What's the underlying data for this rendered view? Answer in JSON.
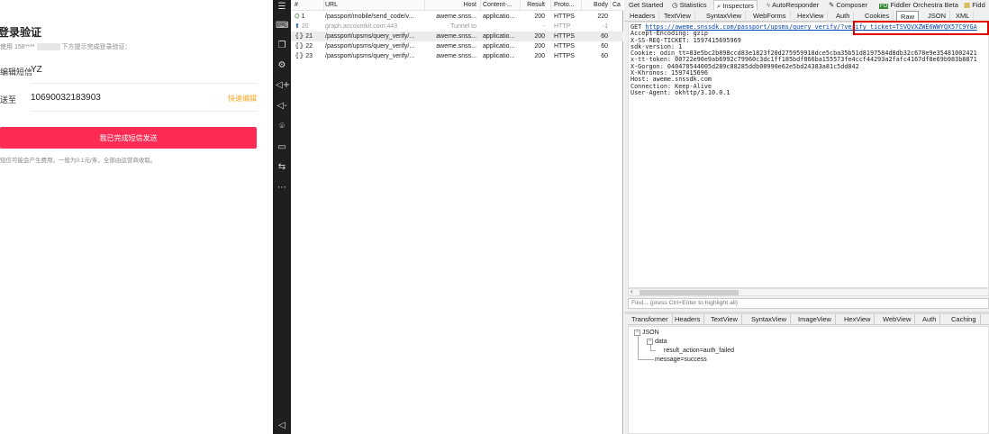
{
  "phone": {
    "title": "登录验证",
    "subtitle_prefix": "使用 158****",
    "subtitle_suffix": "下方提示完成登录验证：",
    "sms_label": "编辑短信",
    "sms_value": "YZ",
    "send_to_label": "送至",
    "send_to_value": "10690032183903",
    "quick_edit": "快速编辑",
    "confirm_button": "我已完成短信发送",
    "note": "短信可能会产生费用，一般为0.1元/条，全部由运营商收取。",
    "button_color": "#fe2c55"
  },
  "sidebar_icons": [
    "list-icon",
    "keyboard-icon",
    "copy-icon",
    "gear-icon",
    "volume-up-icon",
    "volume-down-icon",
    "location-icon",
    "folder-icon",
    "screen-icon",
    "more-icon",
    "back-icon"
  ],
  "sessions": {
    "columns": [
      "#",
      "URL",
      "Host",
      "Content-...",
      "Result",
      "Proto...",
      "Body",
      "Ca"
    ],
    "rows": [
      {
        "num": "1",
        "url": "/passport/mobile/send_code/v...",
        "host": "aweme.snss...",
        "content": "applicatio...",
        "result": "200",
        "proto": "HTTPS",
        "body": "220",
        "icon": "json-icon"
      },
      {
        "num": "20",
        "url": "graph.accountkit.com:443",
        "host": "Tunnel to",
        "content": "",
        "result": "-",
        "proto": "HTTP",
        "body": "-1",
        "icon": "upload-arrow-icon"
      },
      {
        "num": "21",
        "url": "/passport/upsms/query_verify/...",
        "host": "aweme.snss...",
        "content": "applicatio...",
        "result": "200",
        "proto": "HTTPS",
        "body": "60",
        "icon": "json-icon"
      },
      {
        "num": "22",
        "url": "/passport/upsms/query_verify/...",
        "host": "aweme.snss...",
        "content": "applicatio...",
        "result": "200",
        "proto": "HTTPS",
        "body": "60",
        "icon": "json-icon"
      },
      {
        "num": "23",
        "url": "/passport/upsms/query_verify/...",
        "host": "aweme.snss...",
        "content": "applicatio...",
        "result": "200",
        "proto": "HTTPS",
        "body": "60",
        "icon": "json-icon"
      }
    ]
  },
  "inspector": {
    "top_tabs": [
      "Get Started",
      "Statistics",
      "Inspectors",
      "AutoResponder",
      "Composer",
      "Fiddler Orchestra Beta",
      "Fidd"
    ],
    "request_tabs": [
      "Headers",
      "TextView",
      "SyntaxView",
      "WebForms",
      "HexView",
      "Auth",
      "Cookies",
      "Raw",
      "JSON",
      "XML"
    ],
    "request": {
      "method": "GET",
      "url": "https://aweme.snssdk.com/passport/upsms/query_verify/?verify_ticket=TSVQVXZWE6WWYQX57C9YGA",
      "lines": [
        "Accept-Encoding: gzip",
        "X-SS-REQ-TICKET: 1597415695969",
        "sdk-version: 1",
        "Cookie: odin_tt=83e5bc2b898ccd83e1823f20d275959918dce5cba35b51d8197584d8db32c678e9e35481002421",
        "x-tt-token: 00722e90e9ab6992c79960c3dc1ff185bdf866ba155573fe4ccf44293a2fafc4167df8e69b983b8871",
        "X-Gorgon: 040470544005d289c88285ddb00990e62e5bd24383a81c5dd842",
        "X-Khronos: 1597415696",
        "Host: aweme.snssdk.com",
        "Connection: Keep-Alive",
        "User-Agent: okhttp/3.10.0.1"
      ]
    },
    "find_placeholder": "Find... (press Ctrl+Enter to highlight all)",
    "response_tabs": [
      "Transformer",
      "Headers",
      "TextView",
      "SyntaxView",
      "ImageView",
      "HexView",
      "WebView",
      "Auth",
      "Caching"
    ],
    "json_tree": {
      "root": "JSON",
      "data_node": "data",
      "result_action": "result_action=auth_failed",
      "message": "message=success"
    }
  }
}
